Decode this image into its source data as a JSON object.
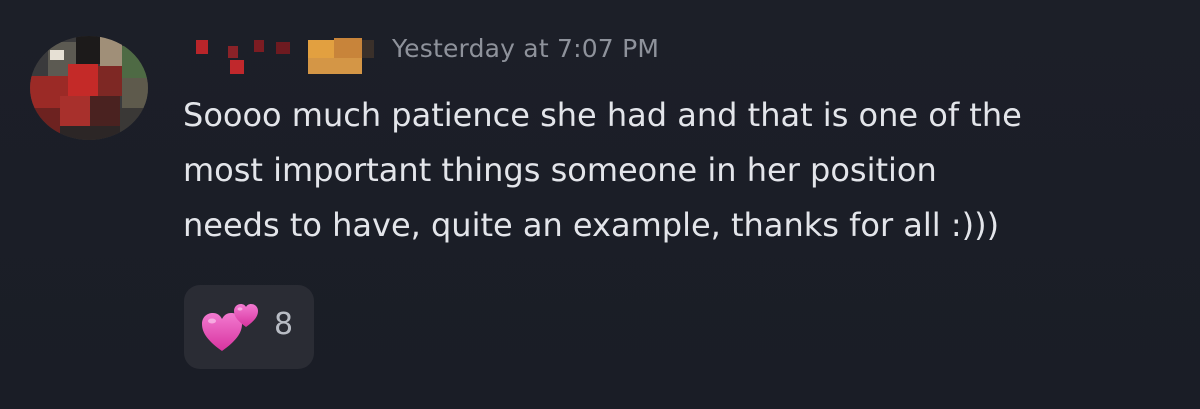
{
  "message": {
    "author_redacted": true,
    "timestamp": "Yesterday at 7:07 PM",
    "content_lines": [
      "Soooo much patience she had and that is one of the",
      "most important things someone in her position",
      "needs to have, quite an example, thanks for all  :)))"
    ],
    "reaction": {
      "emoji": "two-hearts-icon",
      "count": "8"
    }
  },
  "colors": {
    "background": "#1b1e27",
    "text": "#e3e5ea",
    "timestamp": "#8e929b",
    "reaction_bg": "#2a2c34",
    "heart": "#e23fae"
  }
}
